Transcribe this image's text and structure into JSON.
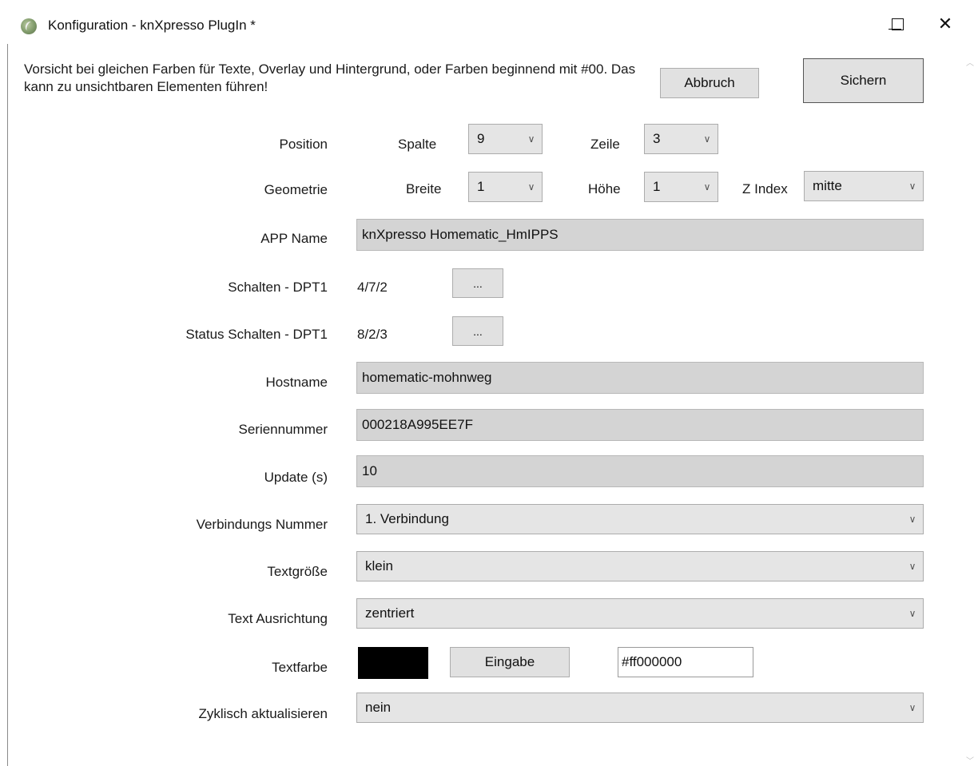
{
  "window": {
    "title": "Konfiguration - knXpresso PlugIn *",
    "minimize_glyph": "—",
    "close_glyph": "✕"
  },
  "warning": "Vorsicht bei gleichen Farben für Texte, Overlay und Hintergrund, oder Farben beginnend mit #00. Das kann zu unsichtbaren Elementen führen!",
  "buttons": {
    "cancel": "Abbruch",
    "save": "Sichern",
    "browse": "...",
    "input": "Eingabe"
  },
  "position": {
    "label": "Position",
    "column_label": "Spalte",
    "column_value": "9",
    "row_label": "Zeile",
    "row_value": "3"
  },
  "geometry": {
    "label": "Geometrie",
    "width_label": "Breite",
    "width_value": "1",
    "height_label": "Höhe",
    "height_value": "1",
    "zindex_label": "Z Index",
    "zindex_value": "mitte"
  },
  "app_name": {
    "label": "APP Name",
    "value": "knXpresso Homematic_HmIPPS"
  },
  "switch": {
    "label": "Schalten - DPT1",
    "value": "4/7/2"
  },
  "status_switch": {
    "label": "Status Schalten - DPT1",
    "value": "8/2/3"
  },
  "hostname": {
    "label": "Hostname",
    "value": "homematic-mohnweg"
  },
  "serial": {
    "label": "Seriennummer",
    "value": "000218A995EE7F"
  },
  "update": {
    "label": "Update (s)",
    "value": "10"
  },
  "connection": {
    "label": "Verbindungs Nummer",
    "value": "1. Verbindung"
  },
  "text_size": {
    "label": "Textgröße",
    "value": "klein"
  },
  "text_align": {
    "label": "Text Ausrichtung",
    "value": "zentriert"
  },
  "text_color": {
    "label": "Textfarbe",
    "value": "#ff000000",
    "swatch_color": "#000000"
  },
  "cyclic": {
    "label": "Zyklisch aktualisieren",
    "value": "nein"
  },
  "icons": {
    "app": "knxpresso-app-icon",
    "dropdown": "chevron-down-icon"
  }
}
